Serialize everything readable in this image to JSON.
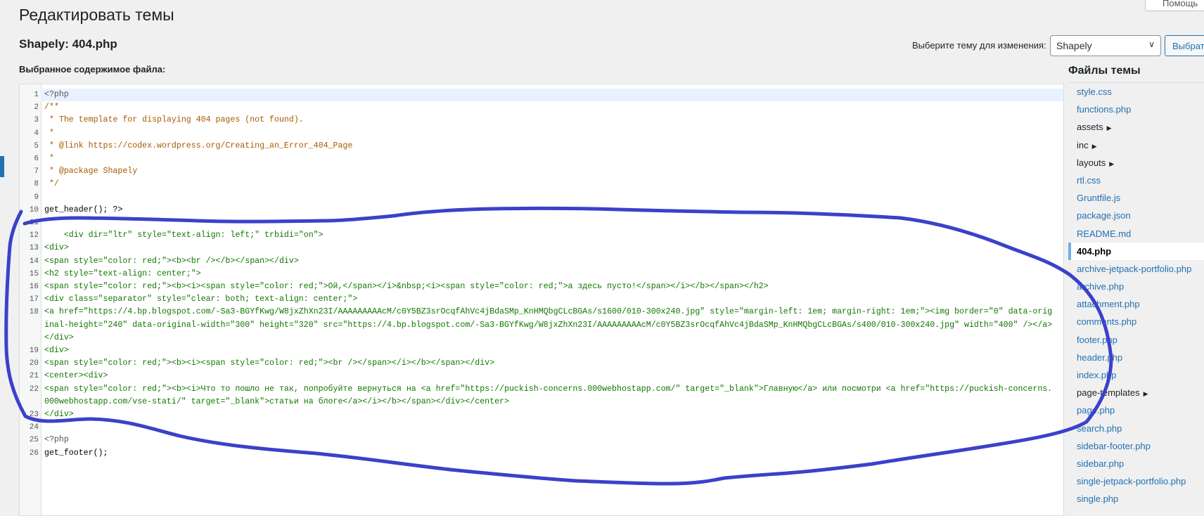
{
  "header": {
    "page_title": "Редактировать темы",
    "help_label": "Помощь",
    "file_title": "Shapely: 404.php",
    "select_label": "Выберите тему для изменения:",
    "selected_theme": "Shapely",
    "select_button": "Выбрать",
    "content_label": "Выбранное содержимое файла:"
  },
  "editor": {
    "lines": [
      {
        "n": "1",
        "text": "<?php"
      },
      {
        "n": "2",
        "text": "/**"
      },
      {
        "n": "3",
        "text": " * The template for displaying 404 pages (not found)."
      },
      {
        "n": "4",
        "text": " *"
      },
      {
        "n": "5",
        "text": " * @link https://codex.wordpress.org/Creating_an_Error_404_Page"
      },
      {
        "n": "6",
        "text": " *"
      },
      {
        "n": "7",
        "text": " * @package Shapely"
      },
      {
        "n": "8",
        "text": " */"
      },
      {
        "n": "9",
        "text": ""
      },
      {
        "n": "10",
        "text": "get_header(); ?>"
      },
      {
        "n": "11",
        "text": ""
      },
      {
        "n": "12",
        "text": "    <div dir=\"ltr\" style=\"text-align: left;\" trbidi=\"on\">"
      },
      {
        "n": "13",
        "text": "<div>"
      },
      {
        "n": "14",
        "text": "<span style=\"color: red;\"><b><br /></b></span></div>"
      },
      {
        "n": "15",
        "text": "<h2 style=\"text-align: center;\">"
      },
      {
        "n": "16",
        "text": "<span style=\"color: red;\"><b><i><span style=\"color: red;\">Ой,</span></i>&nbsp;<i><span style=\"color: red;\">а здесь пусто!</span></i></b></span></h2>"
      },
      {
        "n": "17",
        "text": "<div class=\"separator\" style=\"clear: both; text-align: center;\">"
      },
      {
        "n": "18",
        "text": "<a href=\"https://4.bp.blogspot.com/-Sa3-BGYfKwg/W8jxZhXn23I/AAAAAAAAAcM/c0Y5BZ3srOcqfAhVc4jBdaSMp_KnHMQbgCLcBGAs/s1600/010-300x240.jpg\" style=\"margin-left: 1em; margin-right: 1em;\"><img border=\"0\" data-original-height=\"240\" data-original-width=\"300\" height=\"320\" src=\"https://4.bp.blogspot.com/-Sa3-BGYfKwg/W8jxZhXn23I/AAAAAAAAAcM/c0Y5BZ3srOcqfAhVc4jBdaSMp_KnHMQbgCLcBGAs/s400/010-300x240.jpg\" width=\"400\" /></a></div>"
      },
      {
        "n": "19",
        "text": "<div>"
      },
      {
        "n": "20",
        "text": "<span style=\"color: red;\"><b><i><span style=\"color: red;\"><br /></span></i></b></span></div>"
      },
      {
        "n": "21",
        "text": "<center><div>"
      },
      {
        "n": "22",
        "text": "<span style=\"color: red;\"><b><i>Что то пошло не так, попробуйте вернуться на <a href=\"https://puckish-concerns.000webhostapp.com/\" target=\"_blank\">Главную</a> или посмотри <a href=\"https://puckish-concerns.000webhostapp.com/vse-stati/\" target=\"_blank\">статьи на блоге</a></i></b></span></div></center>"
      },
      {
        "n": "23",
        "text": "</div>"
      },
      {
        "n": "24",
        "text": ""
      },
      {
        "n": "25",
        "text": "<?php"
      },
      {
        "n": "26",
        "text": "get_footer();"
      }
    ]
  },
  "files": {
    "title": "Файлы темы",
    "items": [
      {
        "label": "style.css",
        "folder": false
      },
      {
        "label": "functions.php",
        "folder": false
      },
      {
        "label": "assets",
        "folder": true
      },
      {
        "label": "inc",
        "folder": true
      },
      {
        "label": "layouts",
        "folder": true
      },
      {
        "label": "rtl.css",
        "folder": false
      },
      {
        "label": "Gruntfile.js",
        "folder": false
      },
      {
        "label": "package.json",
        "folder": false
      },
      {
        "label": "README.md",
        "folder": false
      },
      {
        "label": "404.php",
        "folder": false,
        "active": true
      },
      {
        "label": "archive-jetpack-portfolio.php",
        "folder": false
      },
      {
        "label": "archive.php",
        "folder": false
      },
      {
        "label": "attachment.php",
        "folder": false
      },
      {
        "label": "comments.php",
        "folder": false
      },
      {
        "label": "footer.php",
        "folder": false
      },
      {
        "label": "header.php",
        "folder": false
      },
      {
        "label": "index.php",
        "folder": false
      },
      {
        "label": "page-templates",
        "folder": true
      },
      {
        "label": "page.php",
        "folder": false
      },
      {
        "label": "search.php",
        "folder": false
      },
      {
        "label": "sidebar-footer.php",
        "folder": false
      },
      {
        "label": "sidebar.php",
        "folder": false
      },
      {
        "label": "single-jetpack-portfolio.php",
        "folder": false
      },
      {
        "label": "single.php",
        "folder": false
      }
    ]
  },
  "colors": {
    "accent": "#2271b1",
    "annotation": "#3b41c9"
  }
}
